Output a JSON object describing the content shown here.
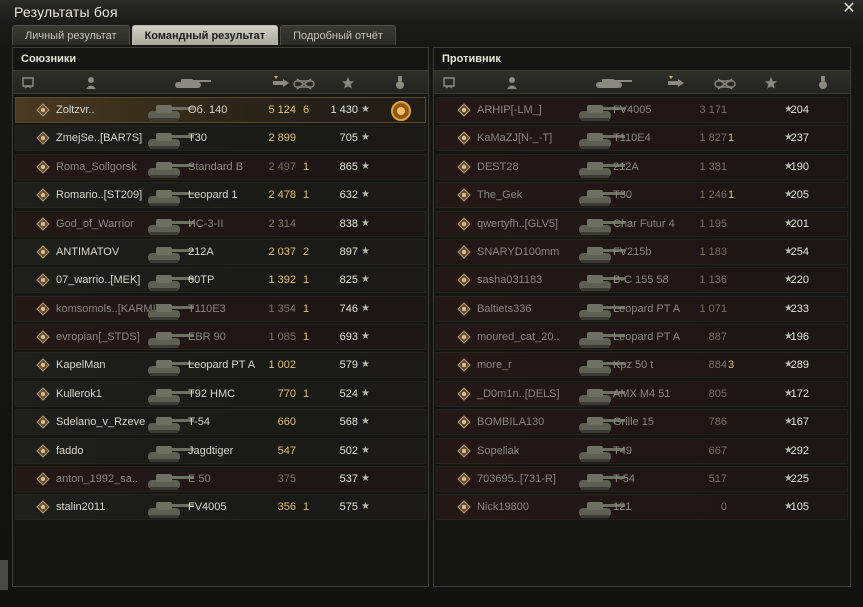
{
  "window": {
    "title": "Результаты боя",
    "close_label": "✕"
  },
  "tabs": [
    {
      "label": "Личный результат",
      "active": false
    },
    {
      "label": "Командный результат",
      "active": true
    },
    {
      "label": "Подробный отчёт",
      "active": false
    }
  ],
  "allies": {
    "title": "Союзники",
    "columns": [
      "squad-icon",
      "player-icon",
      "tank-icon",
      "damage-icon",
      "kills-icon",
      "experience-star-icon",
      "medal-icon"
    ],
    "rows": [
      {
        "player": "Zoltzvr..",
        "tank": "Об. 140",
        "damage": "5 124",
        "kills": "6",
        "exp": "1 430",
        "dead": false,
        "me": true,
        "medal": true
      },
      {
        "player": "ZmejSe..[BAR7S]",
        "tank": "T30",
        "damage": "2 899",
        "kills": "",
        "exp": "705",
        "dead": false
      },
      {
        "player": "Roma_Soligorsk",
        "tank": "Standard B",
        "damage": "2 497",
        "kills": "1",
        "exp": "865",
        "dead": true
      },
      {
        "player": "Romario..[ST209]",
        "tank": "Leopard 1",
        "damage": "2 478",
        "kills": "1",
        "exp": "632",
        "dead": false
      },
      {
        "player": "God_of_Warrior",
        "tank": "ИС-3-II",
        "damage": "2 314",
        "kills": "",
        "exp": "838",
        "dead": true
      },
      {
        "player": "ANTIMATOV",
        "tank": "212A",
        "damage": "2 037",
        "kills": "2",
        "exp": "897",
        "dead": false
      },
      {
        "player": "07_warrio..[MEK]",
        "tank": "60TP",
        "damage": "1 392",
        "kills": "1",
        "exp": "825",
        "dead": false
      },
      {
        "player": "komsomols..[KARMI]",
        "tank": "T110E3",
        "damage": "1 354",
        "kills": "1",
        "exp": "746",
        "dead": true
      },
      {
        "player": "evropian[_STDS]",
        "tank": "EBR 90",
        "damage": "1 085",
        "kills": "1",
        "exp": "693",
        "dead": true
      },
      {
        "player": "KapelMan",
        "tank": "Leopard PT A",
        "damage": "1 002",
        "kills": "",
        "exp": "579",
        "dead": false
      },
      {
        "player": "Kullerok1",
        "tank": "T92 HMC",
        "damage": "770",
        "kills": "1",
        "exp": "524",
        "dead": false
      },
      {
        "player": "Sdelano_v_Rzeve",
        "tank": "T-54",
        "damage": "660",
        "kills": "",
        "exp": "568",
        "dead": false
      },
      {
        "player": "faddo",
        "tank": "Jagdtiger",
        "damage": "547",
        "kills": "",
        "exp": "502",
        "dead": false
      },
      {
        "player": "anton_1992_sa..",
        "tank": "E 50",
        "damage": "375",
        "kills": "",
        "exp": "537",
        "dead": true
      },
      {
        "player": "stalin2011",
        "tank": "FV4005",
        "damage": "356",
        "kills": "1",
        "exp": "575",
        "dead": false
      }
    ]
  },
  "enemies": {
    "title": "Противник",
    "rows": [
      {
        "player": "ARHIP[-LM_]",
        "tank": "FV4005",
        "damage": "3 171",
        "kills": "",
        "exp": "204",
        "dead": true
      },
      {
        "player": "KaMaZJ[N-_-T]",
        "tank": "T110E4",
        "damage": "1 827",
        "kills": "1",
        "exp": "237",
        "dead": true
      },
      {
        "player": "DEST28",
        "tank": "212A",
        "damage": "1 381",
        "kills": "",
        "exp": "190",
        "dead": true
      },
      {
        "player": "The_Gek",
        "tank": "T30",
        "damage": "1 246",
        "kills": "1",
        "exp": "205",
        "dead": true
      },
      {
        "player": "qwertyfh..[GLV5]",
        "tank": "Char Futur 4",
        "damage": "1 195",
        "kills": "",
        "exp": "201",
        "dead": true
      },
      {
        "player": "SNARYD100mm",
        "tank": "FV215b",
        "damage": "1 183",
        "kills": "",
        "exp": "254",
        "dead": true
      },
      {
        "player": "sasha031183",
        "tank": "B-C 155 58",
        "damage": "1 136",
        "kills": "",
        "exp": "220",
        "dead": true
      },
      {
        "player": "Baltiets336",
        "tank": "Leopard PT A",
        "damage": "1 071",
        "kills": "",
        "exp": "233",
        "dead": true
      },
      {
        "player": "moured_cat_20..",
        "tank": "Leopard PT A",
        "damage": "887",
        "kills": "",
        "exp": "196",
        "dead": true
      },
      {
        "player": "more_r",
        "tank": "Kpz 50 t",
        "damage": "884",
        "kills": "3",
        "exp": "289",
        "dead": true
      },
      {
        "player": "_D0m1n..[DELS]",
        "tank": "AMX M4 51",
        "damage": "805",
        "kills": "",
        "exp": "172",
        "dead": true
      },
      {
        "player": "BOMBILA130",
        "tank": "Grille 15",
        "damage": "786",
        "kills": "",
        "exp": "167",
        "dead": true
      },
      {
        "player": "Sopeliak",
        "tank": "T49",
        "damage": "667",
        "kills": "",
        "exp": "292",
        "dead": true
      },
      {
        "player": "703695..[731-R]",
        "tank": "T-54",
        "damage": "517",
        "kills": "",
        "exp": "225",
        "dead": true
      },
      {
        "player": "Nick19800",
        "tank": "121",
        "damage": "0",
        "kills": "",
        "exp": "105",
        "dead": true
      }
    ]
  },
  "icons": {
    "star": "★",
    "rank": "rank-emblem-icon",
    "tank": "tank-silhouette-icon"
  },
  "colors": {
    "damage": "#e0c070",
    "dead_row": "#241817",
    "self_row": "#4a3a22"
  }
}
